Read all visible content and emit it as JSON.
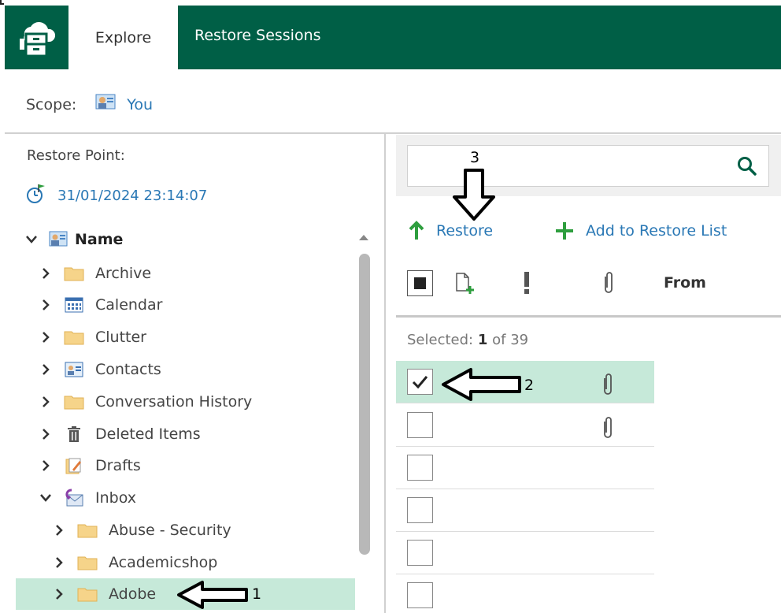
{
  "nav": {
    "logo_icon": "veeam-mailbox-icon",
    "tab_explore": "Explore",
    "tab_restore_sessions": "Restore Sessions",
    "brand_color": "#005f46"
  },
  "scope": {
    "label": "Scope:",
    "value": "You"
  },
  "restore_point": {
    "label": "Restore Point:",
    "value": "31/01/2024 23:14:07"
  },
  "tree": {
    "root": "Name",
    "items": [
      {
        "label": "Archive",
        "icon": "folder-icon"
      },
      {
        "label": "Calendar",
        "icon": "calendar-icon"
      },
      {
        "label": "Clutter",
        "icon": "folder-icon"
      },
      {
        "label": "Contacts",
        "icon": "contacts-icon"
      },
      {
        "label": "Conversation History",
        "icon": "folder-icon"
      },
      {
        "label": "Deleted Items",
        "icon": "trash-icon"
      },
      {
        "label": "Drafts",
        "icon": "drafts-icon"
      },
      {
        "label": "Inbox",
        "icon": "inbox-icon"
      }
    ],
    "children": [
      {
        "label": "Abuse - Security",
        "icon": "folder-icon"
      },
      {
        "label": "Academicshop",
        "icon": "folder-icon"
      },
      {
        "label": "Adobe",
        "icon": "folder-icon"
      }
    ]
  },
  "search": {
    "placeholder": ""
  },
  "actions": {
    "restore": "Restore",
    "add_to_restore_list": "Add to Restore List"
  },
  "columns": {
    "from": "From"
  },
  "selection": {
    "prefix": "Selected:",
    "count": "1",
    "middle": "of",
    "total": "39"
  },
  "annotations": {
    "one": "1",
    "two": "2",
    "three": "3"
  }
}
